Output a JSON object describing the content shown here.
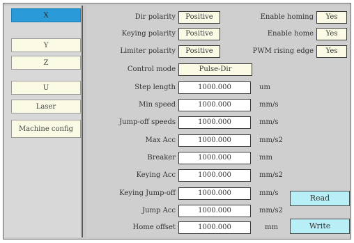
{
  "sidebar": {
    "items": [
      "X",
      "Y",
      "Z",
      "U",
      "Laser",
      "Machine config"
    ]
  },
  "settings": {
    "dir_polarity": {
      "label": "Dir polarity",
      "value": "Positive"
    },
    "keying_polarity": {
      "label": "Keying polarity",
      "value": "Positive"
    },
    "limiter_polarity": {
      "label": "Limiter polarity",
      "value": "Positive"
    },
    "enable_homing": {
      "label": "Enable homing",
      "value": "Yes"
    },
    "enable_home": {
      "label": "Enable home",
      "value": "Yes"
    },
    "pwm_rising_edge": {
      "label": "PWM rising edge",
      "value": "Yes"
    },
    "control_mode": {
      "label": "Control mode",
      "value": "Pulse-Dir"
    }
  },
  "params": [
    {
      "label": "Step length",
      "value": "1000.000",
      "unit": "um"
    },
    {
      "label": "Min speed",
      "value": "1000.000",
      "unit": "mm/s"
    },
    {
      "label": "Jump-off speeds",
      "value": "1000.000",
      "unit": "mm/s"
    },
    {
      "label": "Max Acc",
      "value": "1000.000",
      "unit": "mm/s2"
    },
    {
      "label": "Breaker",
      "value": "1000.000",
      "unit": "mm"
    },
    {
      "label": "Keying Acc",
      "value": "1000.000",
      "unit": "mm/s2"
    },
    {
      "label": "Keying Jump-off",
      "value": "1000.000",
      "unit": "mm/s"
    },
    {
      "label": "Jump Acc",
      "value": "1000.000",
      "unit": "mm/s2"
    },
    {
      "label": "Home offset",
      "value": "1000.000",
      "unit": "mm"
    }
  ],
  "buttons": {
    "read": "Read",
    "write": "Write"
  }
}
